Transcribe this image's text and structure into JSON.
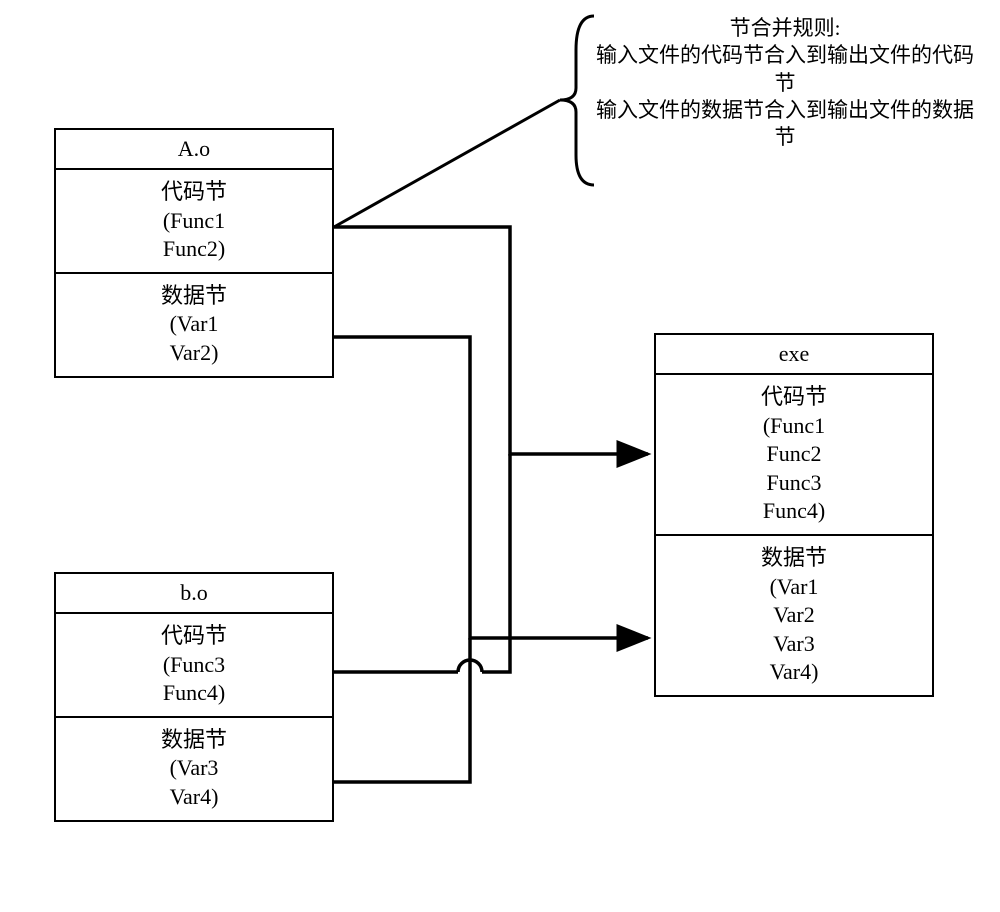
{
  "rule": {
    "title": "节合并规则:",
    "line1": "输入文件的代码节合入到输出文件的代码节",
    "line2": "输入文件的数据节合入到输出文件的数据节"
  },
  "boxA": {
    "title": "A.o",
    "codeLabel": "代码节",
    "codeItem1": "(Func1",
    "codeItem2": "Func2)",
    "dataLabel": "数据节",
    "dataItem1": "(Var1",
    "dataItem2": "Var2)"
  },
  "boxB": {
    "title": "b.o",
    "codeLabel": "代码节",
    "codeItem1": "(Func3",
    "codeItem2": "Func4)",
    "dataLabel": "数据节",
    "dataItem1": "(Var3",
    "dataItem2": "Var4)"
  },
  "boxExe": {
    "title": "exe",
    "codeLabel": "代码节",
    "codeItem1": "(Func1",
    "codeItem2": "Func2",
    "codeItem3": "Func3",
    "codeItem4": "Func4)",
    "dataLabel": "数据节",
    "dataItem1": "(Var1",
    "dataItem2": "Var2",
    "dataItem3": "Var3",
    "dataItem4": "Var4)"
  }
}
